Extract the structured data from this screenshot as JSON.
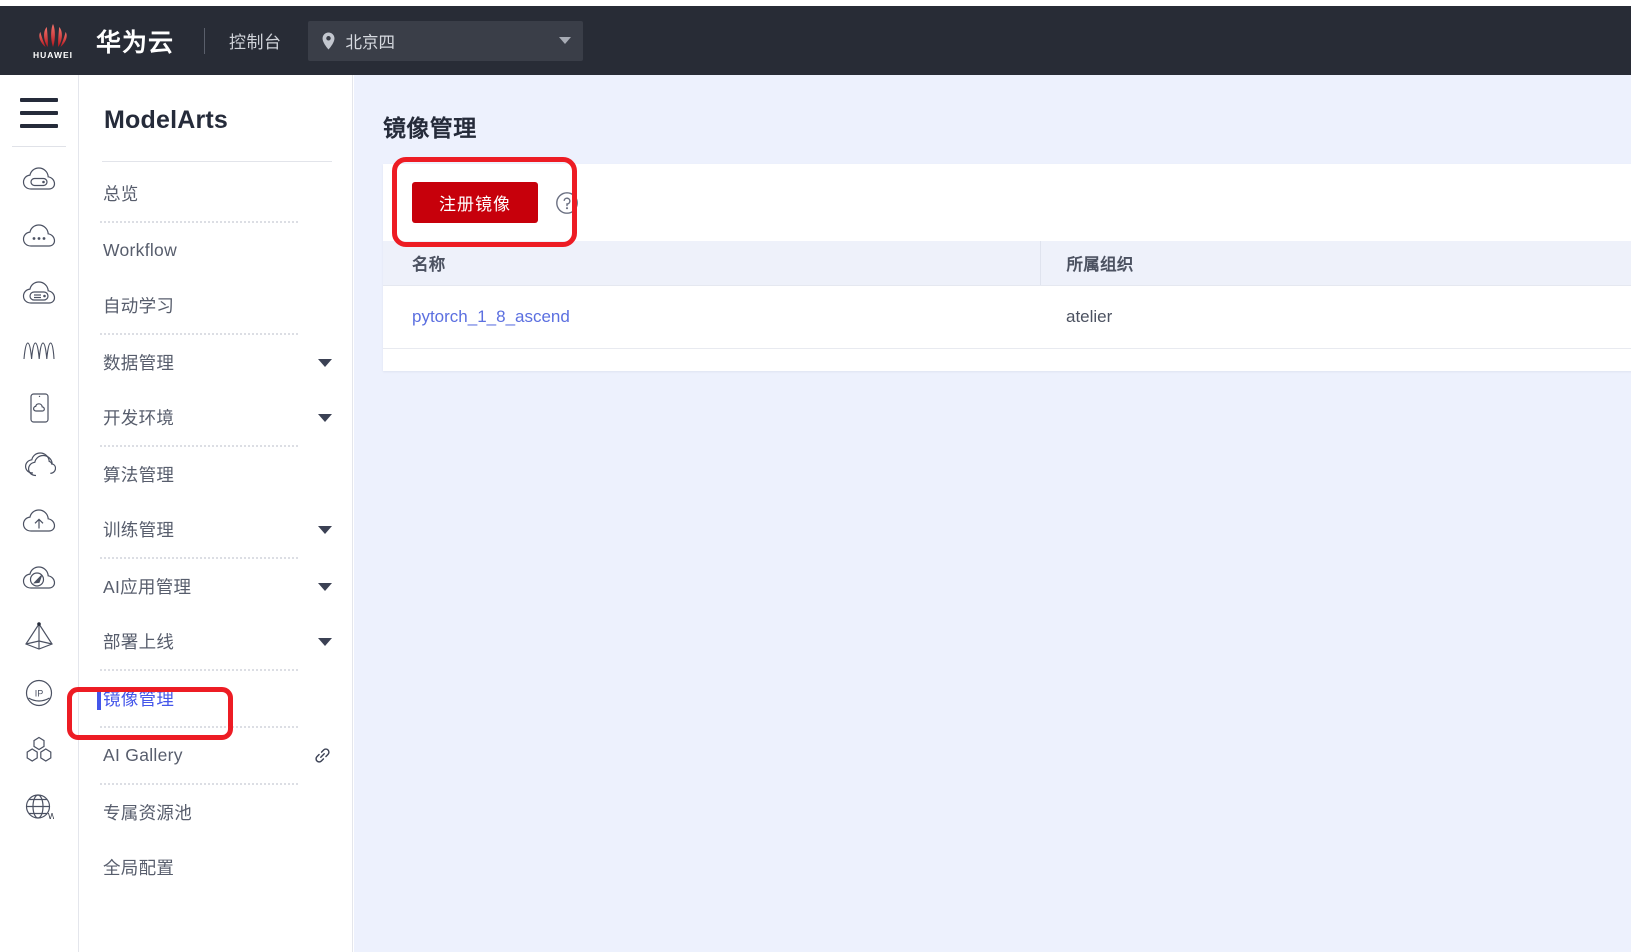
{
  "header": {
    "logo_name": "huawei-logo",
    "logo_word": "HUAWEI",
    "brand": "华为云",
    "console_label": "控制台",
    "region": {
      "icon": "location-pin-icon",
      "value": "北京四",
      "caret": "chevron-down-icon"
    },
    "bg_color": "#282c36"
  },
  "icon_rail": {
    "menu_icon": "hamburger-menu-icon",
    "icons": [
      "cloud-server-icon",
      "cloud-more-icon",
      "cloud-storage-icon",
      "wave-chart-icon",
      "mobile-cloud-icon",
      "cloud-stack-icon",
      "cloud-upload-icon",
      "cloud-cdn-icon",
      "pyramid-icon",
      "ip-circle-icon",
      "cluster-nodes-icon",
      "globe-web-icon"
    ]
  },
  "nav": {
    "title": "ModelArts",
    "items": [
      {
        "label": "总览",
        "expandable": false,
        "active": false,
        "separator_after": true
      },
      {
        "label": "Workflow",
        "expandable": false,
        "active": false,
        "separator_after": false
      },
      {
        "label": "自动学习",
        "expandable": false,
        "active": false,
        "separator_after": true
      },
      {
        "label": "数据管理",
        "expandable": true,
        "active": false,
        "separator_after": false
      },
      {
        "label": "开发环境",
        "expandable": true,
        "active": false,
        "separator_after": true
      },
      {
        "label": "算法管理",
        "expandable": false,
        "active": false,
        "separator_after": false
      },
      {
        "label": "训练管理",
        "expandable": true,
        "active": false,
        "separator_after": true
      },
      {
        "label": "AI应用管理",
        "expandable": true,
        "active": false,
        "separator_after": false
      },
      {
        "label": "部署上线",
        "expandable": true,
        "active": false,
        "separator_after": true
      },
      {
        "label": "镜像管理",
        "expandable": false,
        "active": true,
        "separator_after": true
      },
      {
        "label": "AI Gallery",
        "expandable": false,
        "active": false,
        "external": true,
        "separator_after": true
      },
      {
        "label": "专属资源池",
        "expandable": false,
        "active": false,
        "separator_after": false
      },
      {
        "label": "全局配置",
        "expandable": false,
        "active": false,
        "separator_after": false
      }
    ],
    "active_color": "#4456ea",
    "external_icon": "external-link-icon"
  },
  "main": {
    "page_title": "镜像管理",
    "toolbar": {
      "register_button": "注册镜像",
      "help_icon": "question-mark-circle-icon",
      "button_color": "#c7000b"
    },
    "table": {
      "columns": [
        "名称",
        "所属组织"
      ],
      "rows": [
        {
          "name": "pytorch_1_8_ascend",
          "organization": "atelier"
        }
      ]
    },
    "background_color": "#edf1fd"
  },
  "annotations": {
    "highlight_color": "#ed1c24",
    "boxes": [
      "register-image-button-highlight",
      "image-management-nav-highlight"
    ]
  }
}
